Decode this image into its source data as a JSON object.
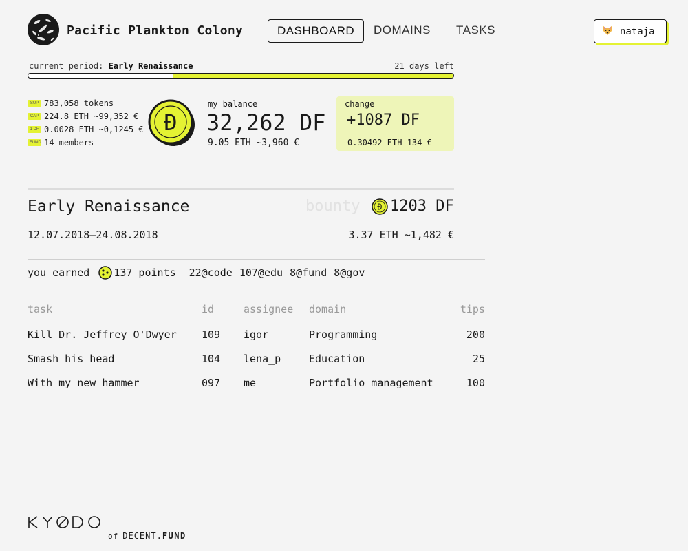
{
  "app": {
    "colony_name": "Pacific Plankton Colony",
    "nav": [
      {
        "label": "DASHBOARD",
        "active": true
      },
      {
        "label": "DOMAINS",
        "active": false
      },
      {
        "label": "TASKS",
        "active": false
      }
    ],
    "user": {
      "name": "nataja",
      "icon": "fox-avatar-icon"
    }
  },
  "period": {
    "label_prefix": "current period: ",
    "name": "Early Renaissance",
    "days_left": "21 days left",
    "progress_fraction": 0.66
  },
  "stats": [
    {
      "tag": "SUP",
      "text": "783,058 tokens"
    },
    {
      "tag": "CAP",
      "text": "224.8 ETH  ~99,352 €"
    },
    {
      "tag": "1 DF",
      "text": "0.0028 ETH  ~0,1245 €"
    },
    {
      "tag": "FUND",
      "text": "14 members"
    }
  ],
  "balance": {
    "label": "my balance",
    "value": "32,262 DF",
    "sub": "9.05 ETH  ~3,960 €",
    "coin_glyph": "Ɖ"
  },
  "change": {
    "label": "change",
    "value": "+1087 DF",
    "sub": "0.30492 ETH  134 €"
  },
  "detail": {
    "name": "Early Renaissance",
    "bounty_word": "bounty",
    "bounty_value": "1203 DF",
    "dates": "12.07.2018–24.08.2018",
    "bounty_sub": "3.37 ETH  ~1,482 €",
    "earned_prefix": "you earned",
    "earned_points": "137 points",
    "domain_points": [
      "22@code",
      "107@edu",
      "8@fund",
      "8@gov"
    ]
  },
  "table": {
    "headers": [
      "task",
      "id",
      "assignee",
      "domain",
      "tips"
    ],
    "rows": [
      [
        "Kill Dr. Jeffrey O'Dwyer",
        "109",
        "igor",
        "Programming",
        "200"
      ],
      [
        "Smash his head",
        "104",
        "lena_p",
        "Education",
        "25"
      ],
      [
        "With my new hammer",
        "097",
        "me",
        "Portfolio management",
        "100"
      ]
    ]
  },
  "footer": {
    "brand": "KYODO",
    "of": "of",
    "decent": "DECENT.",
    "fund": "FUND"
  },
  "colors": {
    "accent": "#e4f233",
    "change_bg": "#eef5b8",
    "text": "#1a1a1a",
    "muted": "#9a9a9a"
  }
}
